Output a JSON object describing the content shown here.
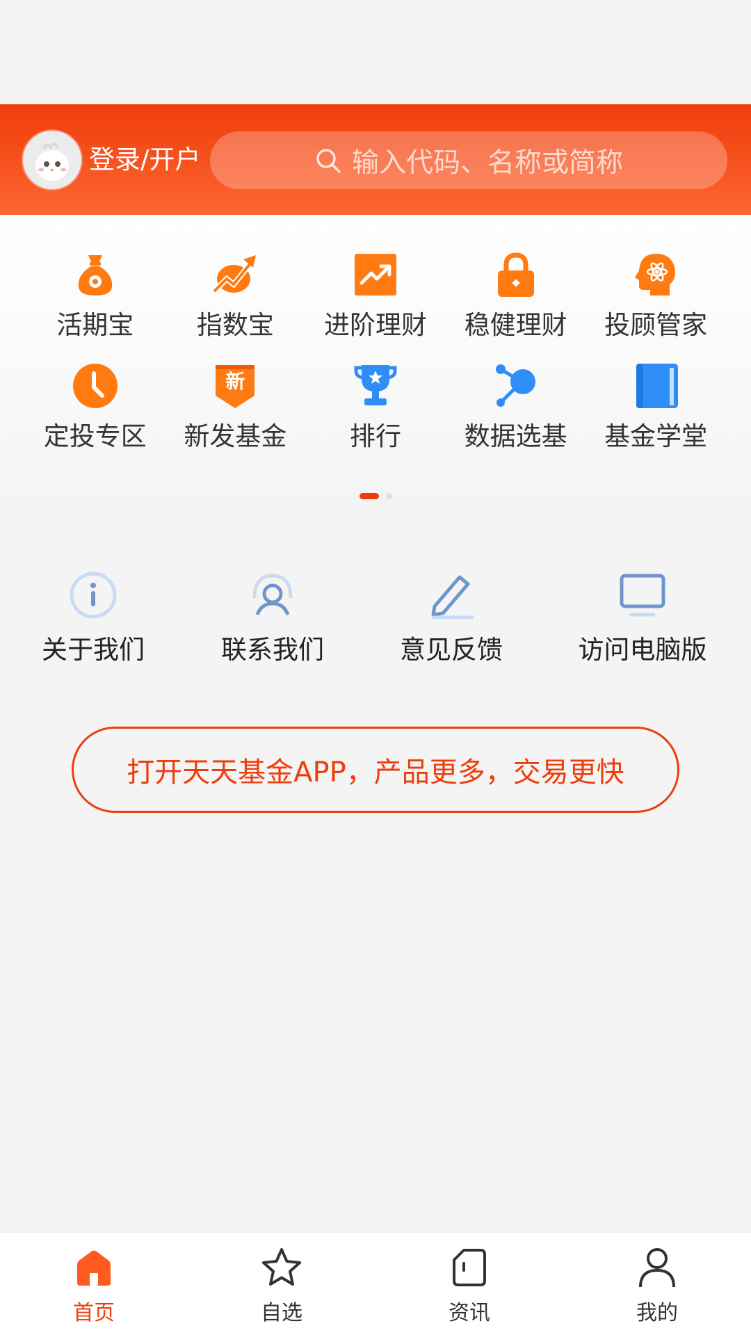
{
  "header": {
    "login_label": "登录/开户",
    "search_placeholder": "输入代码、名称或简称"
  },
  "grid": {
    "items": [
      {
        "label": "活期宝",
        "icon": "money-bag-icon"
      },
      {
        "label": "指数宝",
        "icon": "trend-up-icon"
      },
      {
        "label": "进阶理财",
        "icon": "chart-up-icon"
      },
      {
        "label": "稳健理财",
        "icon": "lock-icon"
      },
      {
        "label": "投顾管家",
        "icon": "brain-icon"
      },
      {
        "label": "定投专区",
        "icon": "clock-icon"
      },
      {
        "label": "新发基金",
        "icon": "new-badge-icon"
      },
      {
        "label": "排行",
        "icon": "trophy-icon"
      },
      {
        "label": "数据选基",
        "icon": "data-nodes-icon"
      },
      {
        "label": "基金学堂",
        "icon": "book-icon"
      }
    ],
    "badge_text": "新",
    "pages": 2,
    "active_page": 1
  },
  "links": {
    "items": [
      {
        "label": "关于我们",
        "icon": "info-icon"
      },
      {
        "label": "联系我们",
        "icon": "contact-icon"
      },
      {
        "label": "意见反馈",
        "icon": "pencil-icon"
      },
      {
        "label": "访问电脑版",
        "icon": "monitor-icon"
      }
    ]
  },
  "app_button": {
    "label": "打开天天基金APP，产品更多，交易更快"
  },
  "tabbar": {
    "tabs": [
      {
        "label": "首页",
        "icon": "home-icon",
        "active": true
      },
      {
        "label": "自选",
        "icon": "star-icon",
        "active": false
      },
      {
        "label": "资讯",
        "icon": "news-icon",
        "active": false
      },
      {
        "label": "我的",
        "icon": "user-icon",
        "active": false
      }
    ]
  },
  "colors": {
    "brand": "#ee3d0c",
    "orange_icon": "#ff7a10",
    "blue_icon": "#2f8ef5",
    "link_icon": "#8fb0dc"
  }
}
